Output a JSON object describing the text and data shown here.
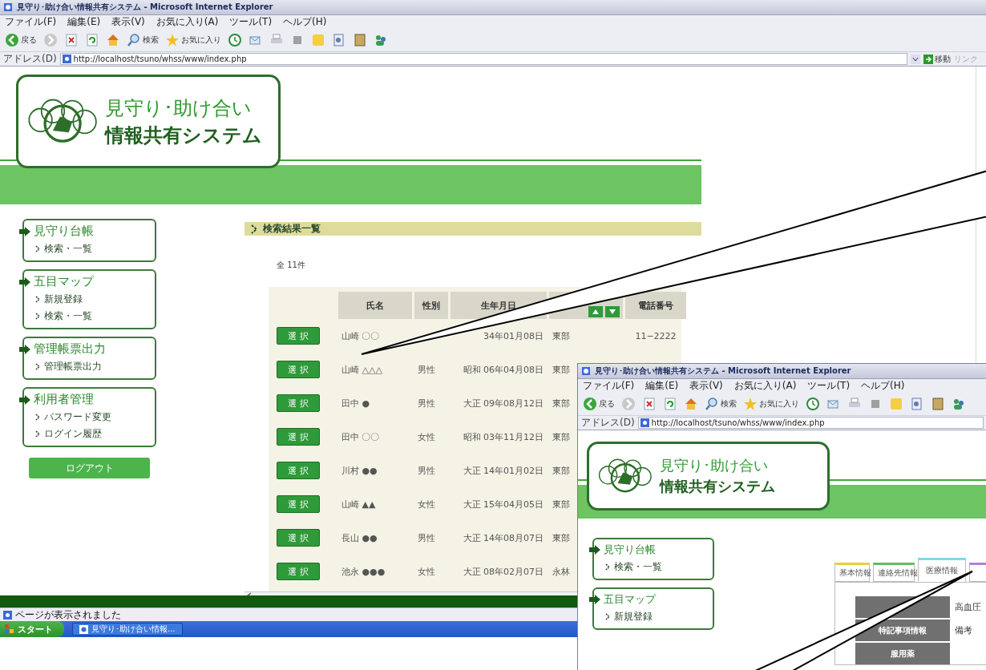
{
  "main_window": {
    "title": "見守り･助け合い情報共有システム - Microsoft Internet Explorer",
    "menu": [
      "ファイル(F)",
      "編集(E)",
      "表示(V)",
      "お気に入り(A)",
      "ツール(T)",
      "ヘルプ(H)"
    ],
    "toolbar": {
      "back": "戻る",
      "search": "検索",
      "favorites": "お気に入り"
    },
    "address": {
      "label": "アドレス(D)",
      "url": "http://localhost/tsuno/whss/www/index.php",
      "go": "移動",
      "links": "リンク"
    },
    "header": {
      "line1": "見守り･助け合い",
      "line2": "情報共有システム"
    },
    "sidebar": [
      {
        "title": "見守り台帳",
        "links": [
          "検索・一覧"
        ]
      },
      {
        "title": "五目マップ",
        "links": [
          "新規登録",
          "検索・一覧"
        ]
      },
      {
        "title": "管理帳票出力",
        "links": [
          "管理帳票出力"
        ]
      },
      {
        "title": "利用者管理",
        "links": [
          "パスワード変更",
          "ログイン履歴"
        ]
      }
    ],
    "logout": "ログアウト",
    "results": {
      "heading": "検索結果一覧",
      "count": "全 11件",
      "columns": [
        {
          "kind": "text",
          "label": "氏名"
        },
        {
          "kind": "text",
          "label": "性別"
        },
        {
          "kind": "text",
          "label": "生年月日"
        },
        {
          "kind": "sort"
        },
        {
          "kind": "text",
          "label": "電話番号"
        }
      ],
      "rows": [
        {
          "button": "選 択",
          "cells": [
            "山崎 〇〇",
            null,
            "34年01月08日",
            "東部",
            "11−2222"
          ]
        },
        {
          "button": "選 択",
          "cells": [
            "山崎 △△△",
            "男性",
            "昭和 06年04月08日",
            "東部"
          ]
        },
        {
          "button": "選 択",
          "cells": [
            "田中 ●",
            "男性",
            "大正 09年08月12日",
            "東部"
          ]
        },
        {
          "button": "選 択",
          "cells": [
            "田中 〇〇",
            "女性",
            "昭和 03年11月12日",
            "東部"
          ]
        },
        {
          "button": "選 択",
          "cells": [
            "川村 ●●",
            "男性",
            "大正 14年01月02日",
            "東部"
          ]
        },
        {
          "button": "選 択",
          "cells": [
            "山崎 ▲▲",
            "女性",
            "大正 15年04月05日",
            "東部"
          ]
        },
        {
          "button": "選 択",
          "cells": [
            "長山 ●●",
            "男性",
            "大正 14年08月07日",
            "東部"
          ]
        },
        {
          "button": "選 択",
          "cells": [
            "池永 ●●●",
            "女性",
            "大正 08年02月07日",
            "永林"
          ]
        }
      ]
    },
    "status": "ページが表示されました",
    "taskbar": {
      "start": "スタート",
      "task": "見守り･助け合い情報..."
    }
  },
  "second_window": {
    "title": "見守り･助け合い情報共有システム - Microsoft Internet Explorer",
    "menu": [
      "ファイル(F)",
      "編集(E)",
      "表示(V)",
      "お気に入り(A)",
      "ツール(T)",
      "ヘルプ(H)"
    ],
    "toolbar": {
      "back": "戻る",
      "search": "検索",
      "favorites": "お気に入り"
    },
    "address": {
      "label": "アドレス(D)",
      "url": "http://localhost/tsuno/whss/www/index.php"
    },
    "header": {
      "line1": "見守り･助け合い",
      "line2": "情報共有システム"
    },
    "sidebar": [
      {
        "title": "見守り台帳",
        "links": [
          "検索・一覧"
        ]
      },
      {
        "title": "五目マップ",
        "links": [
          "新規登録"
        ]
      }
    ],
    "tabs": [
      {
        "label": "基本情報",
        "selected": false,
        "color": "#e8d040"
      },
      {
        "label": "連絡先情報",
        "selected": false,
        "color": "#5cc060"
      },
      {
        "label": "医療情報",
        "selected": true,
        "color": "#80d8e8"
      },
      {
        "selected": false,
        "color": "#b080d8"
      }
    ],
    "details": [
      {
        "value": "高血圧"
      },
      {
        "label": "特記事項情報",
        "value": "備考"
      },
      {
        "label": "服用薬"
      }
    ]
  }
}
